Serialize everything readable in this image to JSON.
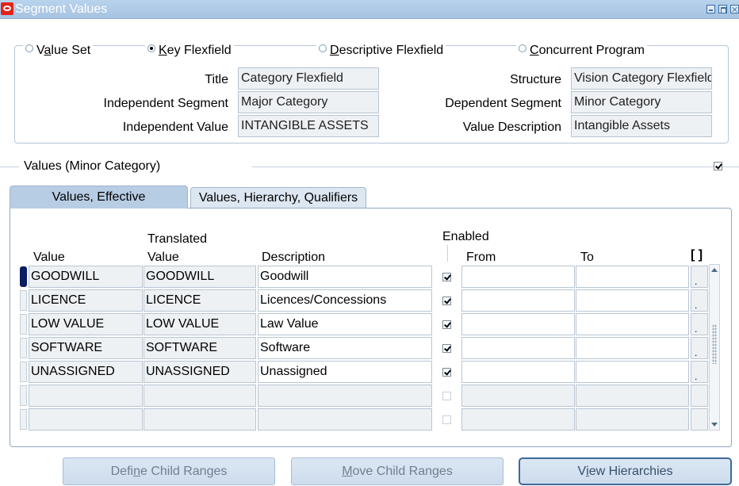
{
  "window": {
    "title": "Segment Values"
  },
  "radios": [
    {
      "pre": "V",
      "u": "a",
      "post": "lue Set",
      "selected": false
    },
    {
      "pre": "",
      "u": "K",
      "post": "ey Flexfield",
      "selected": true
    },
    {
      "pre": "",
      "u": "D",
      "post": "escriptive Flexfield",
      "selected": false
    },
    {
      "pre": "",
      "u": "C",
      "post": "oncurrent Program",
      "selected": false
    }
  ],
  "header": {
    "title_label": "Title",
    "title_value": "Category Flexfield",
    "structure_label": "Structure",
    "structure_value": "Vision Category Flexfield",
    "indep_seg_label": "Independent Segment",
    "indep_seg_value": "Major Category",
    "dep_seg_label": "Dependent Segment",
    "dep_seg_value": "Minor Category",
    "indep_val_label": "Independent Value",
    "indep_val_value": "INTANGIBLE ASSETS",
    "val_desc_label": "Value Description",
    "val_desc_value": "Intangible Assets"
  },
  "section": {
    "title": "Values (Minor Category)",
    "checked": true
  },
  "tabs": {
    "active": "Values, Effective",
    "inactive": "Values, Hierarchy, Qualifiers"
  },
  "columns": {
    "value": "Value",
    "translated_top": "Translated",
    "translated_bottom": "Value",
    "description": "Description",
    "enabled": "Enabled",
    "from": "From",
    "to": "To",
    "df": "[ ]"
  },
  "rows": [
    {
      "value": "GOODWILL",
      "translated": "GOODWILL",
      "description": "Goodwill",
      "enabled": true,
      "from": "",
      "to": ""
    },
    {
      "value": "LICENCE",
      "translated": "LICENCE",
      "description": "Licences/Concessions",
      "enabled": true,
      "from": "",
      "to": ""
    },
    {
      "value": "LOW VALUE",
      "translated": "LOW VALUE",
      "description": "Law Value",
      "enabled": true,
      "from": "",
      "to": ""
    },
    {
      "value": "SOFTWARE",
      "translated": "SOFTWARE",
      "description": "Software",
      "enabled": true,
      "from": "",
      "to": ""
    },
    {
      "value": "UNASSIGNED",
      "translated": "UNASSIGNED",
      "description": "Unassigned",
      "enabled": true,
      "from": "",
      "to": ""
    },
    {
      "value": "",
      "translated": "",
      "description": "",
      "enabled": false,
      "from": "",
      "to": ""
    },
    {
      "value": "",
      "translated": "",
      "description": "",
      "enabled": false,
      "from": "",
      "to": ""
    }
  ],
  "row_dot": ".",
  "buttons": {
    "define_child": {
      "pre": "Defi",
      "u": "n",
      "post": "e Child Ranges"
    },
    "move_child": {
      "pre": "",
      "u": "M",
      "post": "ove Child Ranges"
    },
    "view_hier": {
      "pre": "V",
      "u": "i",
      "post": "ew Hierarchies"
    }
  }
}
